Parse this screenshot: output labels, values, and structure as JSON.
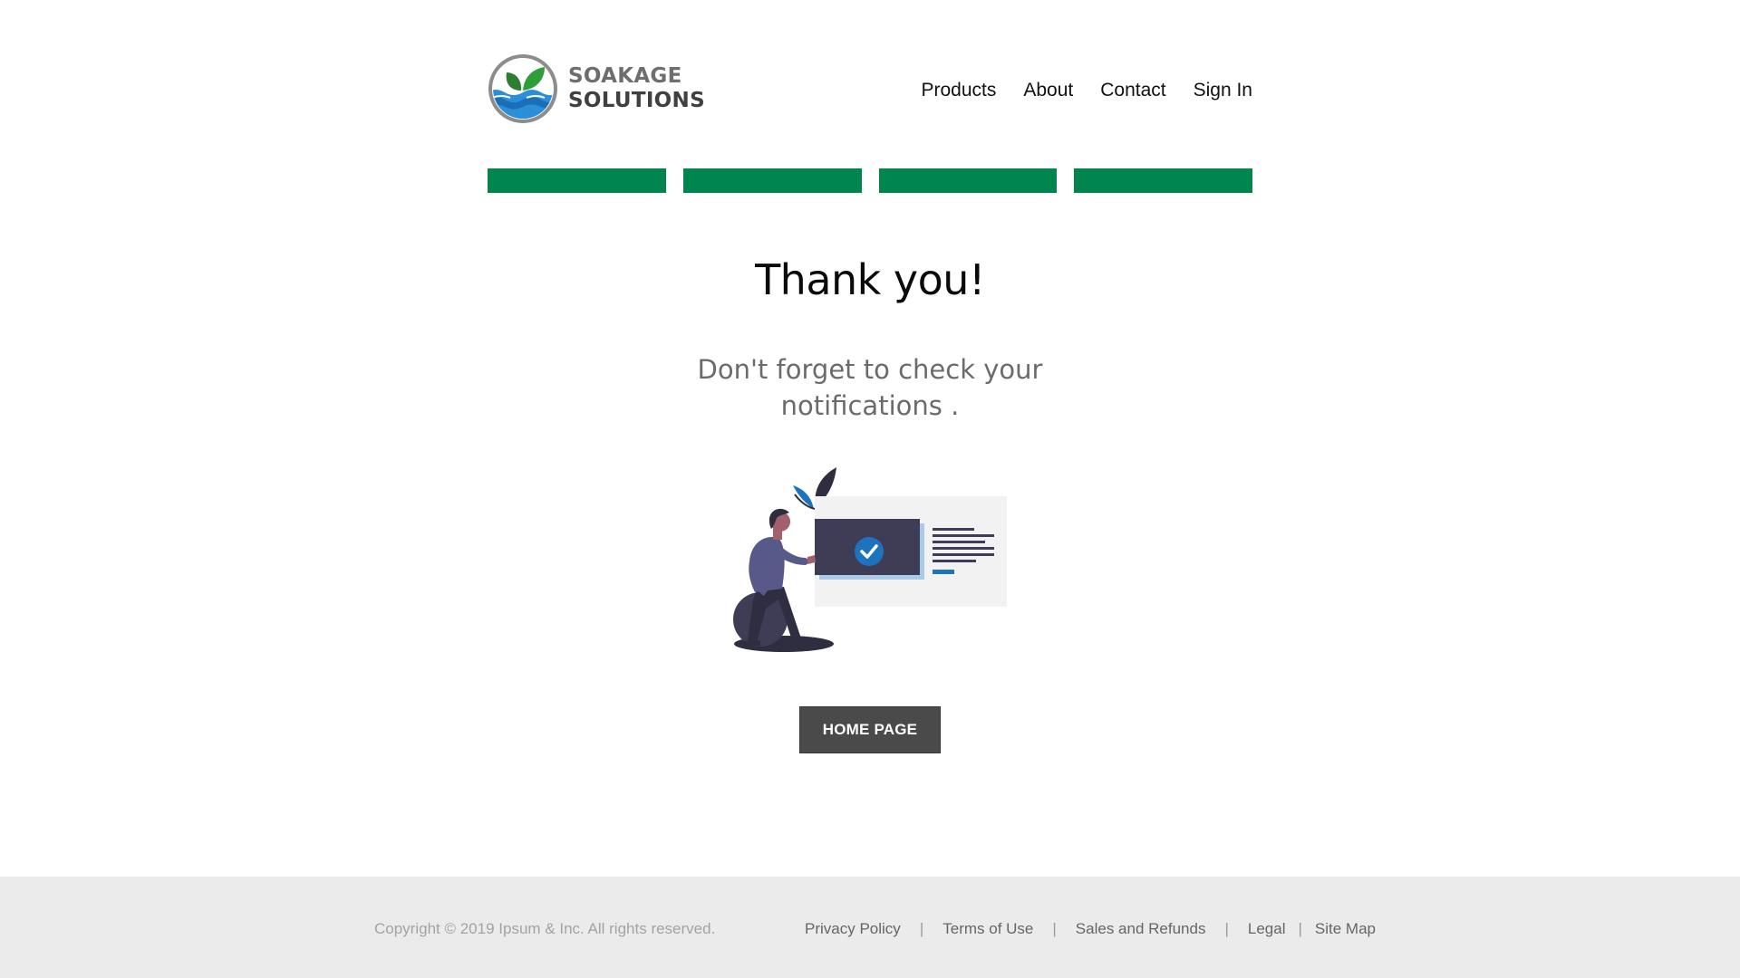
{
  "brand": {
    "line1": "SOAKAGE",
    "line2": "SOLUTIONS",
    "colors": {
      "leaf": "#2e8b3a",
      "water": "#1e7fd0",
      "ring": "#8a8a8a"
    }
  },
  "nav": {
    "items": [
      {
        "label": "Products"
      },
      {
        "label": "About"
      },
      {
        "label": "Contact"
      },
      {
        "label": "Sign In"
      }
    ]
  },
  "steps": {
    "count": 4,
    "completed": 4,
    "color": "#00854f"
  },
  "main": {
    "title": "Thank you!",
    "subtitle": "Don't forget to check your notifications .",
    "illustration_icon": "confirmation-checkmark-illustration",
    "home_button_label": "HOME PAGE"
  },
  "footer": {
    "copyright": "Copyright © 2019 Ipsum & Inc. All rights reserved.",
    "links": [
      {
        "label": "Privacy Policy"
      },
      {
        "label": "Terms of Use"
      },
      {
        "label": "Sales and Refunds"
      },
      {
        "label": "Legal"
      },
      {
        "label": "Site Map"
      }
    ],
    "separator": "|"
  }
}
